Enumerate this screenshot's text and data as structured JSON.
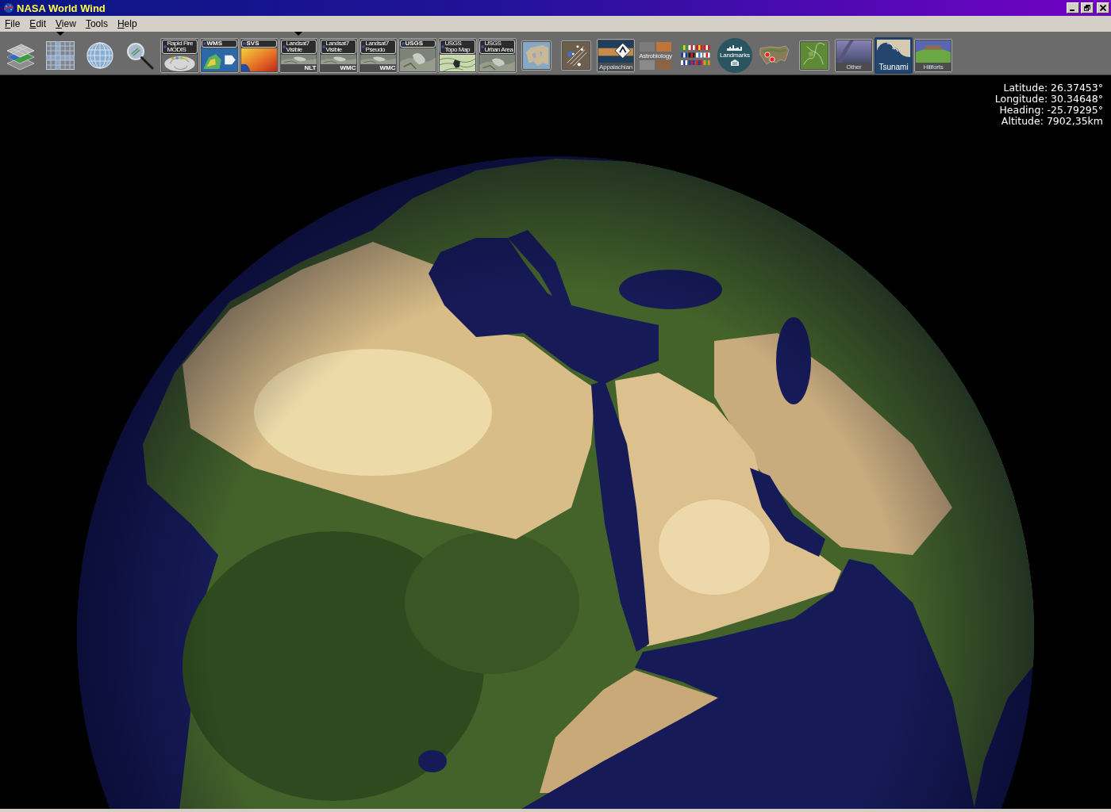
{
  "window": {
    "title": "NASA World Wind"
  },
  "menu": [
    {
      "label": "File"
    },
    {
      "label": "Edit"
    },
    {
      "label": "View"
    },
    {
      "label": "Tools"
    },
    {
      "label": "Help"
    }
  ],
  "toolbar": {
    "items": [
      {
        "kind": "layers",
        "active": false,
        "selected": false
      },
      {
        "kind": "grid",
        "active": true,
        "selected": false
      },
      {
        "kind": "globe",
        "active": false,
        "selected": false
      },
      {
        "kind": "search",
        "active": false,
        "selected": false
      },
      {
        "kind": "storm",
        "banner": [
          "Rapid Fire",
          "MODIS"
        ],
        "active": false,
        "selected": false
      },
      {
        "kind": "colormap",
        "banner": [
          "WMS"
        ],
        "active": false,
        "selected": false
      },
      {
        "kind": "heatmap",
        "banner": [
          "SVS"
        ],
        "active": false,
        "selected": false
      },
      {
        "kind": "photo",
        "banner": [
          "Landsat7",
          "Visible"
        ],
        "corner": "NLT",
        "active": true,
        "selected": false
      },
      {
        "kind": "photo",
        "banner": [
          "Landsat7",
          "Visible"
        ],
        "corner": "WMC",
        "active": false,
        "selected": false
      },
      {
        "kind": "photo",
        "banner": [
          "Landsat7",
          "Pseudo"
        ],
        "corner": "WMC",
        "active": false,
        "selected": false
      },
      {
        "kind": "photo",
        "banner": [
          "USGS"
        ],
        "active": false,
        "selected": false
      },
      {
        "kind": "topo",
        "banner": [
          "USGS",
          "Topo Map"
        ],
        "active": false,
        "selected": false
      },
      {
        "kind": "photo",
        "banner": [
          "USGS",
          "Urban Area"
        ],
        "active": false,
        "selected": false
      },
      {
        "kind": "europe",
        "active": false,
        "selected": false
      },
      {
        "kind": "network",
        "active": false,
        "selected": false
      },
      {
        "kind": "trail",
        "caption": "Appalachian",
        "active": false,
        "selected": false
      },
      {
        "kind": "collage",
        "caption": "Astrobiology",
        "active": false,
        "selected": false
      },
      {
        "kind": "flags",
        "active": false,
        "selected": false
      },
      {
        "kind": "disc",
        "caption": "Landmarks",
        "active": false,
        "selected": false
      },
      {
        "kind": "usmap",
        "active": false,
        "selected": false
      },
      {
        "kind": "terrain",
        "active": false,
        "selected": false
      },
      {
        "kind": "plain",
        "caption": "Other",
        "active": false,
        "selected": false
      },
      {
        "kind": "wave",
        "caption": "Tsunami",
        "active": false,
        "selected": true
      },
      {
        "kind": "hill",
        "caption": "Hillforts",
        "active": false,
        "selected": false
      }
    ]
  },
  "globe_view": {
    "readouts": [
      "Latitude: 26.37453°",
      "Longitude: 30.34648°",
      "Heading: -25.79295°",
      "Altitude: 7902,35km"
    ]
  }
}
